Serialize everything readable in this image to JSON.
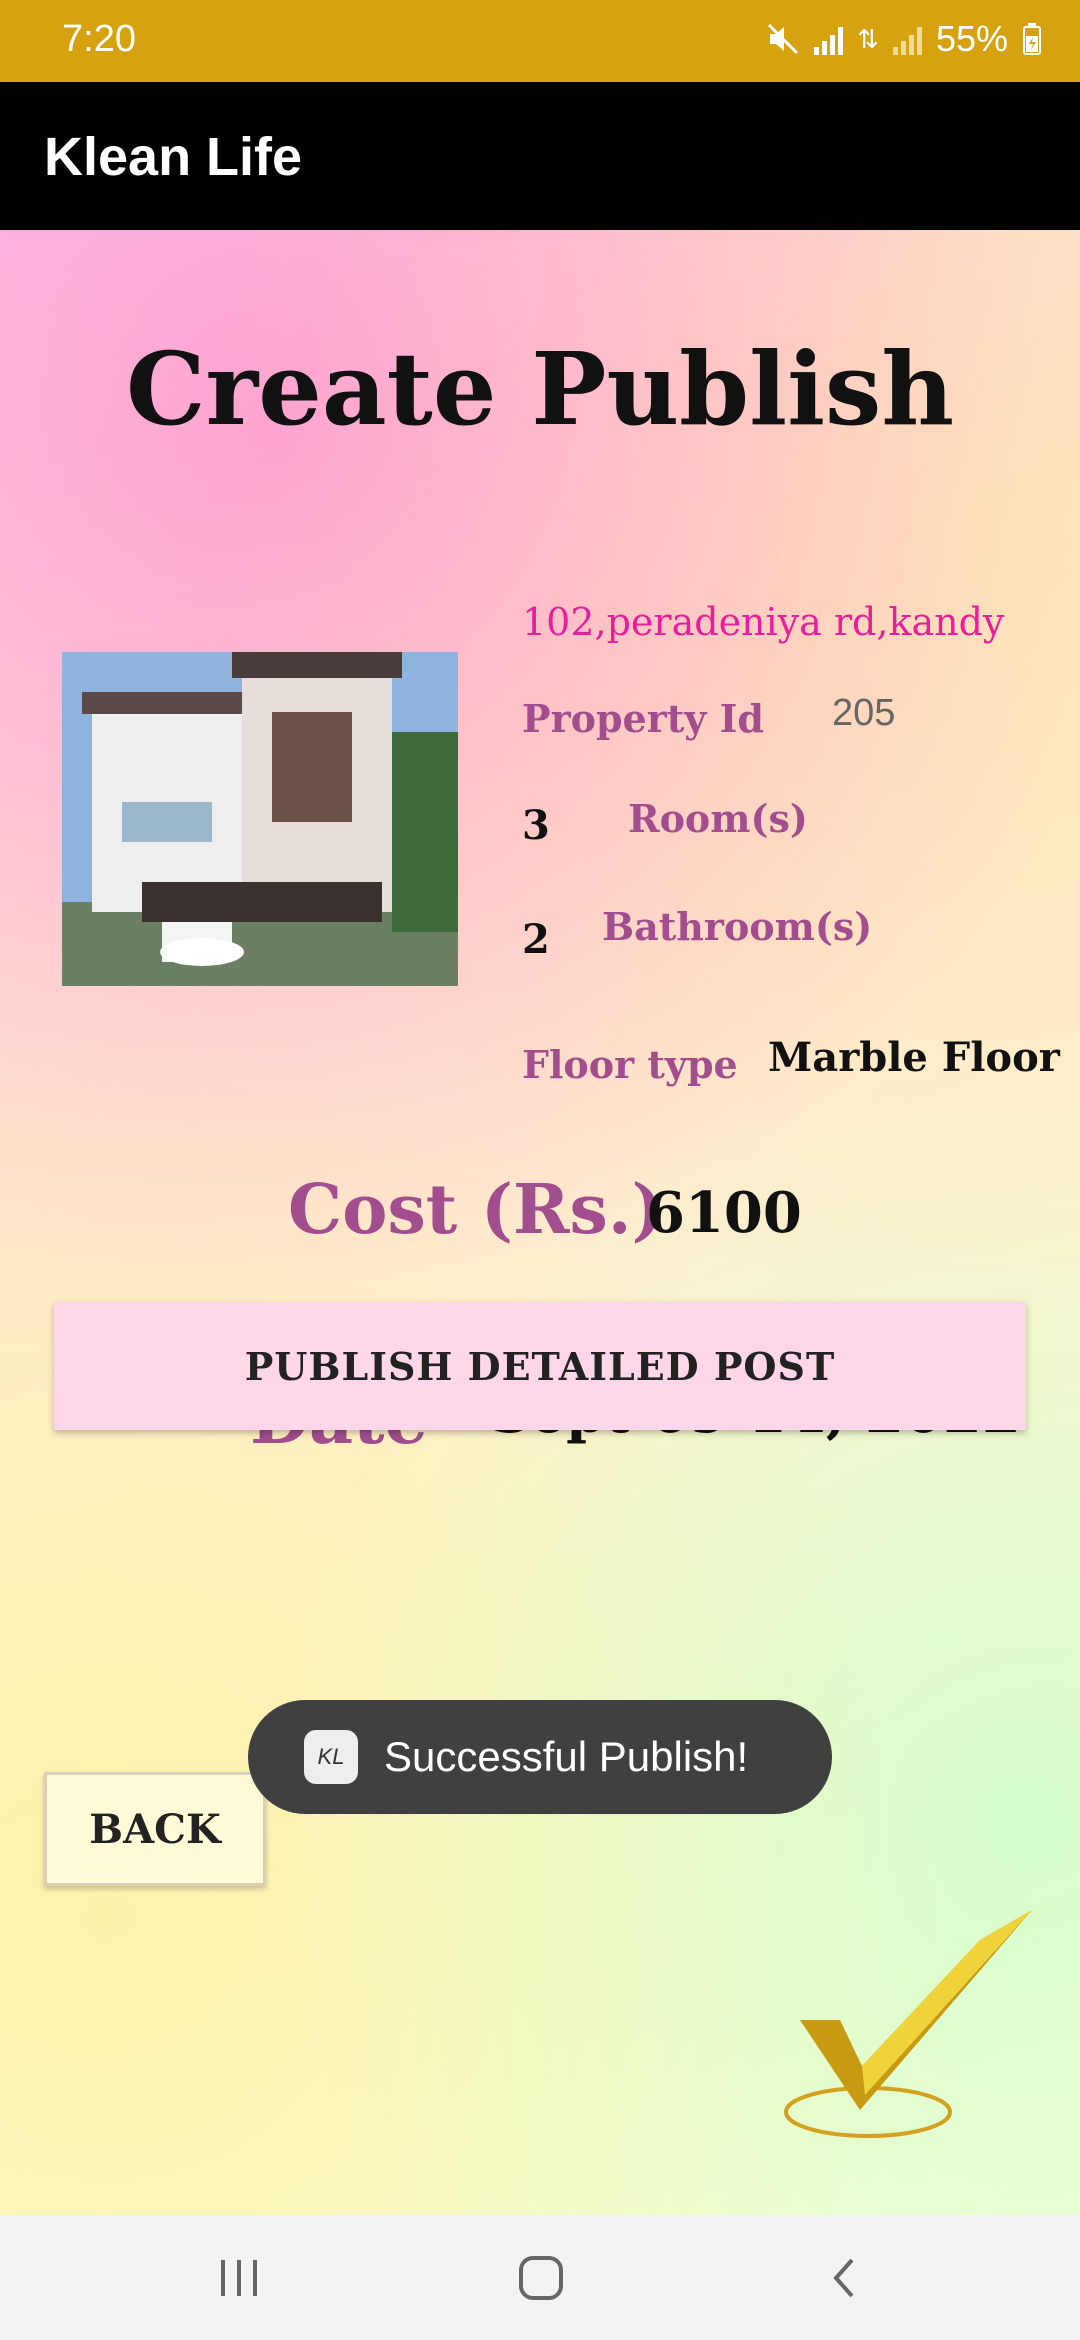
{
  "status_bar": {
    "time": "7:20",
    "battery": "55%"
  },
  "app_bar": {
    "title": "Klean Life"
  },
  "page": {
    "title": "Create Publish"
  },
  "property": {
    "address": "102,peradeniya rd,kandy",
    "property_id_label": "Property Id",
    "property_id": "205",
    "rooms_count": "3",
    "rooms_label": "Room(s)",
    "bathrooms_count": "2",
    "bathrooms_label": "Bathroom(s)",
    "floor_type_label": "Floor type",
    "floor_type": "Marble Floor",
    "cost_label": "Cost (Rs.)",
    "cost": "6100",
    "date_label": "Date",
    "date": "Sept 09 14, 2022"
  },
  "buttons": {
    "publish": "PUBLISH DETAILED POST",
    "back": "BACK"
  },
  "toast": {
    "message": "Successful Publish!",
    "app_icon_text": "KL"
  },
  "colors": {
    "status_bar": "#D6A20F",
    "app_bar": "#000000",
    "label": "#A24E8E",
    "address": "#E91E9C",
    "publish_button": "#FFD6EA"
  }
}
